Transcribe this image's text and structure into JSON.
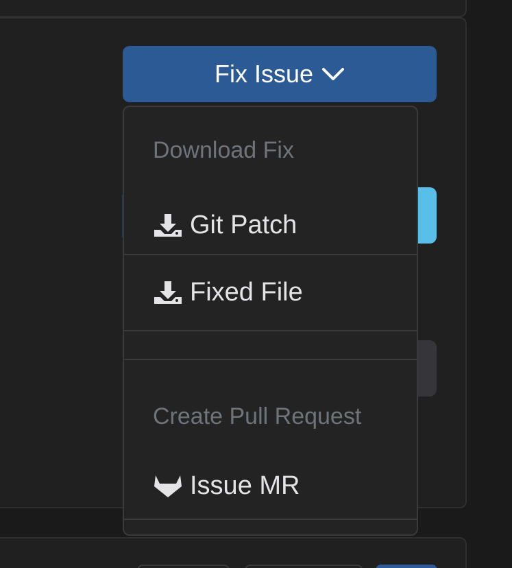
{
  "fix_button": {
    "label": "Fix Issue",
    "icon": "chevron-down-icon"
  },
  "dropdown": {
    "download_section": {
      "header": "Download Fix",
      "items": [
        {
          "label": "Git Patch",
          "icon": "download-icon"
        },
        {
          "label": "Fixed File",
          "icon": "download-icon"
        }
      ]
    },
    "pull_request_section": {
      "header": "Create Pull Request",
      "items": [
        {
          "label": "Issue MR",
          "icon": "gitlab-icon"
        }
      ]
    }
  },
  "colors": {
    "fix_button_bg": "#2c5a94",
    "accent_blue": "#58bfe9",
    "dropdown_bg": "#232324",
    "header_text": "#6f737a",
    "item_text": "#e4e4e6"
  }
}
